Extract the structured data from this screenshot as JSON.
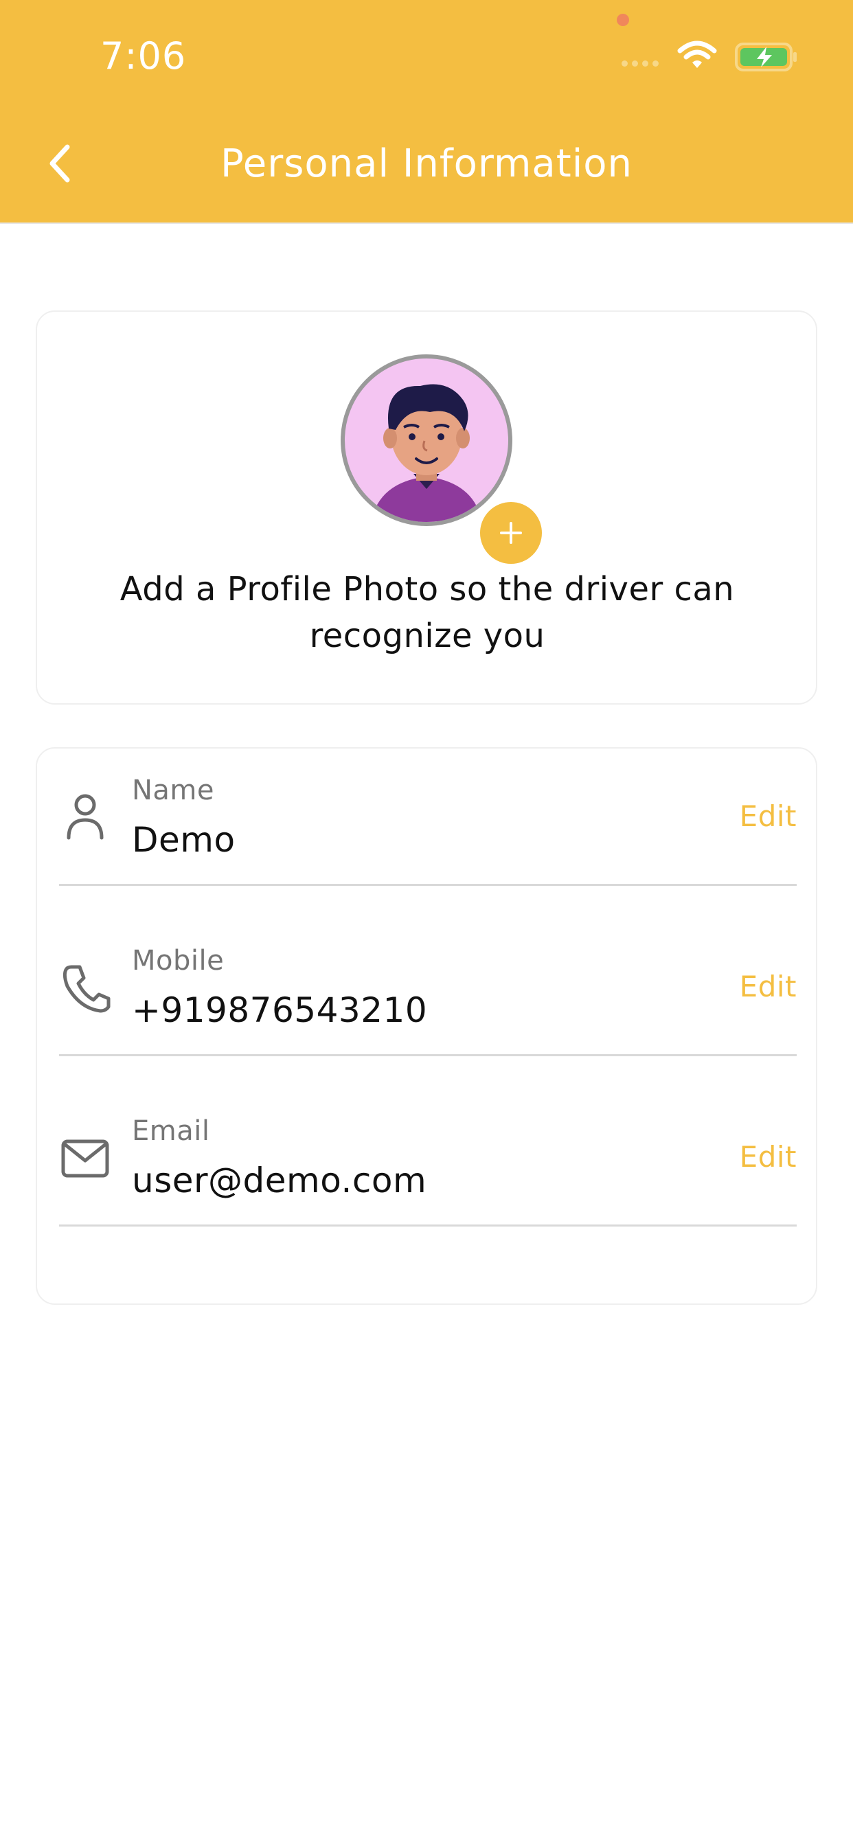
{
  "status_bar": {
    "time": "7:06"
  },
  "header": {
    "title": "Personal Information"
  },
  "photo_card": {
    "caption": "Add a Profile Photo so the driver can recognize you"
  },
  "fields": [
    {
      "label": "Name",
      "value": "Demo",
      "action": "Edit",
      "icon": "user-icon"
    },
    {
      "label": "Mobile",
      "value": "+919876543210",
      "action": "Edit",
      "icon": "phone-icon"
    },
    {
      "label": "Email",
      "value": "user@demo.com",
      "action": "Edit",
      "icon": "mail-icon"
    }
  ],
  "colors": {
    "accent": "#F4BE41",
    "avatar_bg": "#F4C5F2",
    "label": "#757575",
    "text": "#111111"
  }
}
